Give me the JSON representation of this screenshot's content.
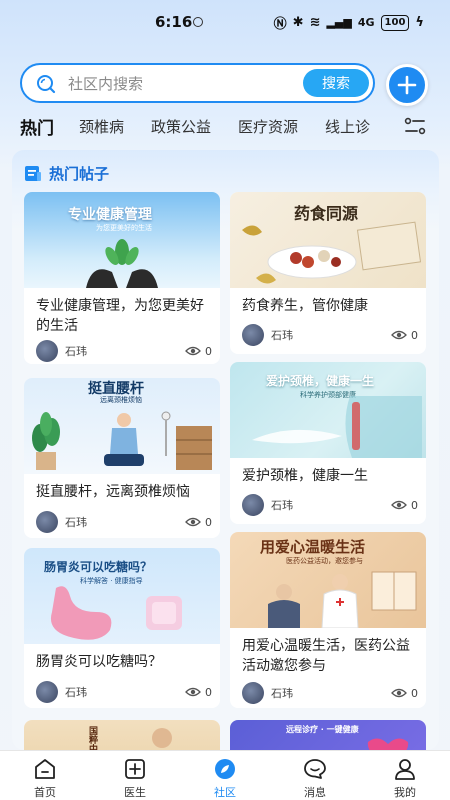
{
  "status_bar": {
    "time": "6:16",
    "network": "4G",
    "battery": "100"
  },
  "search": {
    "placeholder": "社区内搜索",
    "button_label": "搜索"
  },
  "tabs": [
    {
      "label": "热门",
      "active": true
    },
    {
      "label": "颈椎病",
      "active": false
    },
    {
      "label": "政策公益",
      "active": false
    },
    {
      "label": "医疗资源",
      "active": false
    },
    {
      "label": "线上诊",
      "active": false
    }
  ],
  "section": {
    "title": "热门帖子"
  },
  "posts": [
    {
      "image_title": "专业健康管理",
      "image_subtitle": "为您更美好的生活",
      "title": "专业健康管理，为您更美好的生活",
      "author": "石玮",
      "views": "0"
    },
    {
      "image_title": "药食同源",
      "image_subtitle": "",
      "title": "药食养生，管你健康",
      "author": "石玮",
      "views": "0"
    },
    {
      "image_title": "挺直腰杆",
      "image_subtitle": "远离颈椎烦恼",
      "title": "挺直腰杆，远离颈椎烦恼",
      "author": "石玮",
      "views": "0"
    },
    {
      "image_title": "爱护颈椎，健康一生",
      "image_subtitle": "科学养护颈部健康",
      "title": "爱护颈椎，健康一生",
      "author": "石玮",
      "views": "0"
    },
    {
      "image_title": "肠胃炎可以吃糖吗？",
      "image_subtitle": "科学解答 · 健康指导",
      "title": "肠胃炎可以吃糖吗？",
      "author": "石玮",
      "views": "0"
    },
    {
      "image_title": "用爱心温暖生活",
      "image_subtitle": "医药公益活动，邀您参与",
      "title": "用爱心温暖生活，医药公益活动邀您参与",
      "author": "石玮",
      "views": "0"
    },
    {
      "image_title": "国粹中",
      "image_subtitle": "",
      "title": "",
      "author": "",
      "views": ""
    },
    {
      "image_title": "远程诊疗 · 一键健康",
      "image_subtitle": "",
      "title": "",
      "author": "",
      "views": ""
    }
  ],
  "bottom_nav": [
    {
      "label": "首页",
      "icon": "home-icon",
      "active": false
    },
    {
      "label": "医生",
      "icon": "doctor-icon",
      "active": false
    },
    {
      "label": "社区",
      "icon": "community-icon",
      "active": true
    },
    {
      "label": "消息",
      "icon": "message-icon",
      "active": false
    },
    {
      "label": "我的",
      "icon": "profile-icon",
      "active": false
    }
  ],
  "colors": {
    "accent": "#1f8bf2",
    "search_button": "#27a7f4",
    "section_title": "#1a6fd6"
  }
}
